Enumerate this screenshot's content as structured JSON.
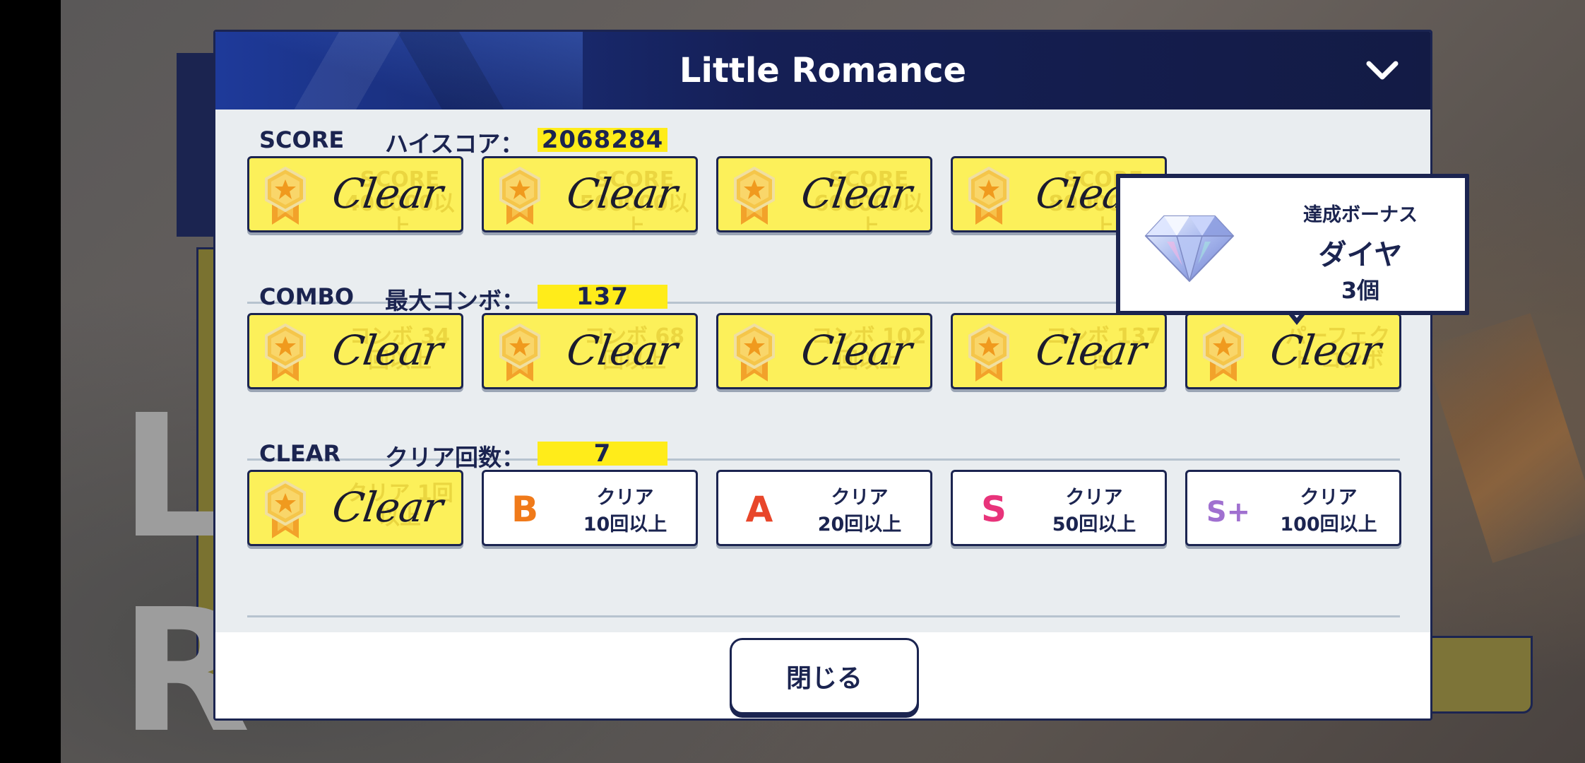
{
  "dialog": {
    "title": "Little Romance",
    "close_label": "閉じる"
  },
  "background": {
    "title_letters": [
      "L",
      "R"
    ]
  },
  "score": {
    "label": "SCORE",
    "sublabel": "ハイスコア：",
    "value": "2068284",
    "badges": [
      {
        "status": "Clear",
        "goal": "SCORE 400000以上"
      },
      {
        "status": "Clear",
        "goal": "SCORE 500000以上"
      },
      {
        "status": "Clear",
        "goal": "SCORE 600000以上"
      },
      {
        "status": "Clear",
        "goal": "SCORE 800000以上"
      }
    ]
  },
  "combo": {
    "label": "COMBO",
    "sublabel": "最大コンボ：",
    "value": "137",
    "badges": [
      {
        "status": "Clear",
        "goal": "コンボ 34回以上"
      },
      {
        "status": "Clear",
        "goal": "コンボ 68回以上"
      },
      {
        "status": "Clear",
        "goal": "コンボ 102回以上"
      },
      {
        "status": "Clear",
        "goal": "コンボ 137回"
      },
      {
        "status": "Clear",
        "goal": "パーフェクト コンボ"
      }
    ]
  },
  "clear": {
    "label": "CLEAR",
    "sublabel": "クリア回数：",
    "value": "7",
    "badges": [
      {
        "status": "Clear",
        "goal": "クリア 1回以上"
      },
      {
        "rank": "B",
        "line1": "クリア",
        "line2": "10回以上",
        "color": "#f07a1a"
      },
      {
        "rank": "A",
        "line1": "クリア",
        "line2": "20回以上",
        "color": "#e8462a"
      },
      {
        "rank": "S",
        "line1": "クリア",
        "line2": "50回以上",
        "color": "#e8337a"
      },
      {
        "rank": "S+",
        "line1": "クリア",
        "line2": "100回以上",
        "color": "#a070d0"
      }
    ]
  },
  "tooltip": {
    "heading": "達成ボーナス",
    "item": "ダイヤ",
    "amount": "3個",
    "icon": "diamond-icon"
  },
  "colors": {
    "navy": "#1b2450",
    "badge_yellow": "#fcf05a",
    "value_highlight": "#ffec1a",
    "body_gray": "#e9edf0"
  }
}
